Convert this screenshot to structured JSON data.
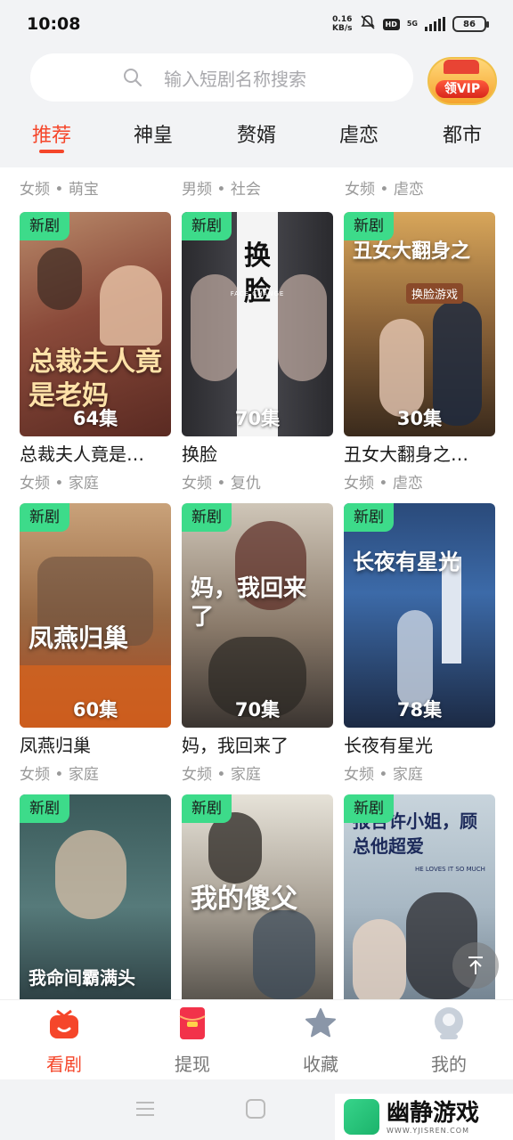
{
  "status_bar": {
    "time": "10:08",
    "speed_value": "0.16",
    "speed_unit": "KB/s",
    "hd": "HD",
    "network": "5G",
    "battery": "86"
  },
  "search": {
    "placeholder": "输入短剧名称搜索",
    "vip_label": "领VIP"
  },
  "tabs": [
    {
      "label": "推荐",
      "active": true
    },
    {
      "label": "神皇",
      "active": false
    },
    {
      "label": "赘婿",
      "active": false
    },
    {
      "label": "虐恋",
      "active": false
    },
    {
      "label": "都市",
      "active": false
    }
  ],
  "previous_row_tags": [
    "女频 • 萌宝",
    "男频 • 社会",
    "女频 • 虐恋"
  ],
  "dramas": [
    {
      "badge": "新剧",
      "poster_text": "总裁夫人竟是老妈",
      "episodes": "64集",
      "title": "总裁夫人竟是…",
      "tags": "女频 • 家庭"
    },
    {
      "badge": "新剧",
      "poster_text": "换脸",
      "poster_sub": "FACE CHANGE",
      "episodes": "70集",
      "title": "换脸",
      "tags": "女频 • 复仇"
    },
    {
      "badge": "新剧",
      "poster_text": "丑女大翻身之",
      "poster_sub": "换脸游戏",
      "episodes": "30集",
      "title": "丑女大翻身之…",
      "tags": "女频 • 虐恋"
    },
    {
      "badge": "新剧",
      "poster_text": "凤燕归巢",
      "episodes": "60集",
      "title": "凤燕归巢",
      "tags": "女频 • 家庭"
    },
    {
      "badge": "新剧",
      "poster_text": "妈，我回来了",
      "episodes": "70集",
      "title": "妈，我回来了",
      "tags": "女频 • 家庭"
    },
    {
      "badge": "新剧",
      "poster_text": "长夜有星光",
      "episodes": "78集",
      "title": "长夜有星光",
      "tags": "女频 • 家庭"
    },
    {
      "badge": "新剧",
      "poster_text": "我命间霸满头",
      "episodes": "",
      "title": "",
      "tags": ""
    },
    {
      "badge": "新剧",
      "poster_text": "我的傻父",
      "episodes": "",
      "title": "",
      "tags": ""
    },
    {
      "badge": "新剧",
      "poster_text": "报告许小姐，顾总他超爱",
      "poster_sub": "HE LOVES IT SO MUCH",
      "episodes": "",
      "title": "",
      "tags": ""
    }
  ],
  "bottom_nav": [
    {
      "label": "看剧",
      "icon": "tv-icon",
      "active": true
    },
    {
      "label": "提现",
      "icon": "red-envelope-icon",
      "active": false
    },
    {
      "label": "收藏",
      "icon": "star-icon",
      "active": false
    },
    {
      "label": "我的",
      "icon": "profile-icon",
      "active": false
    }
  ],
  "watermark": {
    "main": "幽静游戏",
    "url": "WWW.YJISREN.COM"
  },
  "colors": {
    "accent": "#f5462a",
    "badge": "#3ddb8a"
  }
}
